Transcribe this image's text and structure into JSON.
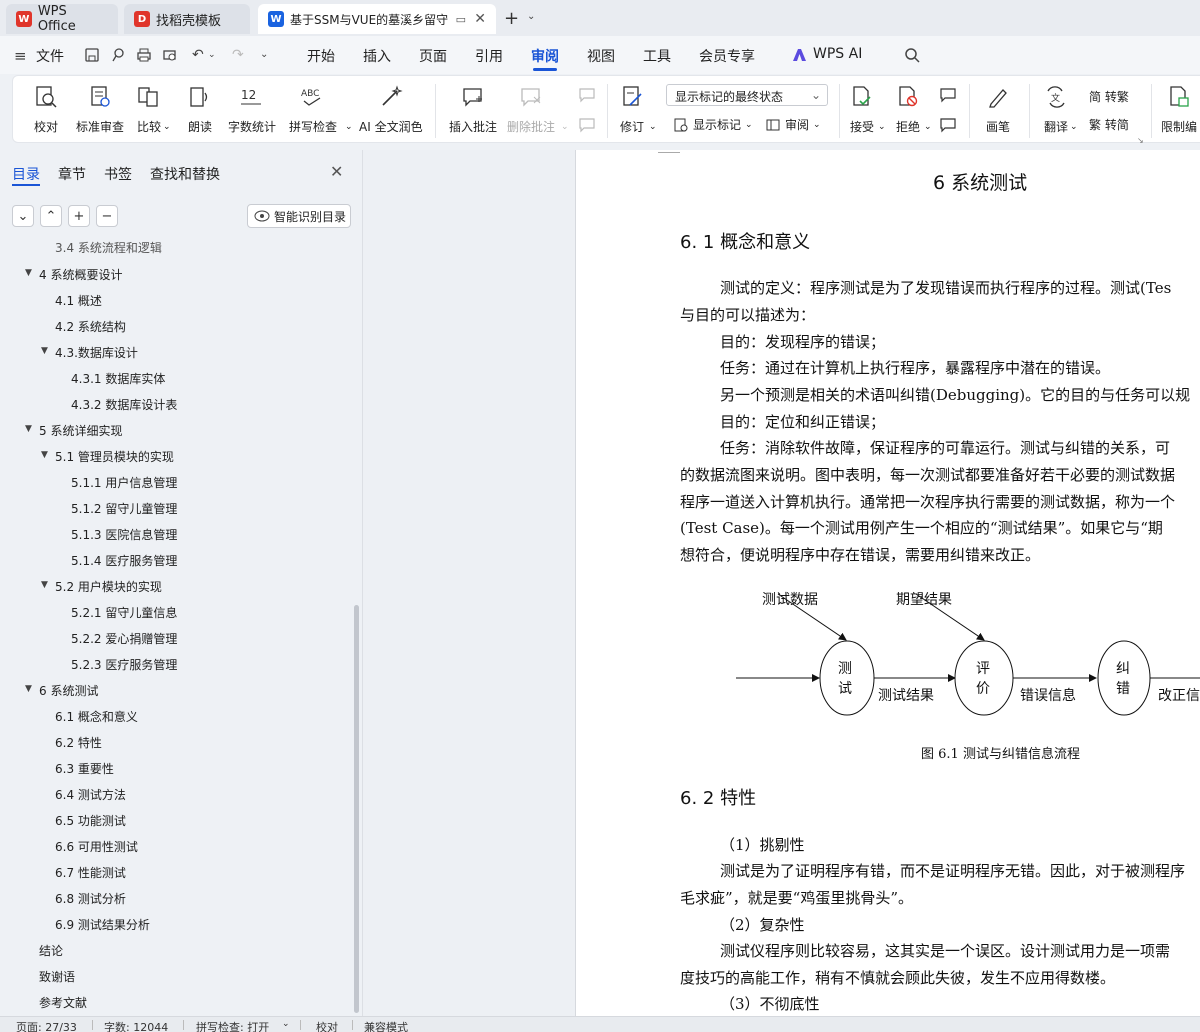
{
  "tabs": [
    {
      "label": "WPS Office",
      "icon": "wps-logo-icon"
    },
    {
      "label": "找稻壳模板",
      "icon": "docer-icon"
    },
    {
      "label": "基于SSM与VUE的墓溪乡留守",
      "icon": "writer-doc-icon"
    }
  ],
  "menu": {
    "file": "文件",
    "items": [
      "开始",
      "插入",
      "页面",
      "引用",
      "审阅",
      "视图",
      "工具",
      "会员专享"
    ],
    "active": "审阅",
    "wps_ai": "WPS AI"
  },
  "ribbon": {
    "proofread": "校对",
    "standard_review": "标准审查",
    "compare": "比较",
    "read_aloud": "朗读",
    "word_count": "字数统计",
    "spell_check": "拼写检查",
    "ai_polish": "AI 全文润色",
    "insert_comment": "插入批注",
    "delete_comment": "删除批注",
    "revise": "修订",
    "markup_view": "显示标记的最终状态",
    "show_markup": "显示标记",
    "review": "审阅",
    "accept": "接受",
    "reject": "拒绝",
    "pen": "画笔",
    "translate": "翻译",
    "to_traditional": "简 转繁",
    "to_simplified": "繁 转简",
    "restrict_edit": "限制编"
  },
  "nav_panel": {
    "tabs": [
      "目录",
      "章节",
      "书签",
      "查找和替换"
    ],
    "active_tab": "目录",
    "smart_toc": "智能识别目录",
    "toc": [
      {
        "label": "3.4 系统流程和逻辑",
        "level": 2,
        "arrow": false
      },
      {
        "label": "4 系统概要设计",
        "level": 1,
        "arrow": true
      },
      {
        "label": "4.1 概述",
        "level": 2,
        "arrow": false
      },
      {
        "label": "4.2 系统结构",
        "level": 2,
        "arrow": false
      },
      {
        "label": "4.3.数据库设计",
        "level": 2,
        "arrow": true
      },
      {
        "label": "4.3.1 数据库实体",
        "level": 3,
        "arrow": false
      },
      {
        "label": "4.3.2 数据库设计表",
        "level": 3,
        "arrow": false
      },
      {
        "label": "5 系统详细实现",
        "level": 1,
        "arrow": true
      },
      {
        "label": "5.1  管理员模块的实现",
        "level": 2,
        "arrow": true
      },
      {
        "label": "5.1.1  用户信息管理",
        "level": 3,
        "arrow": false
      },
      {
        "label": "5.1.2  留守儿童管理",
        "level": 3,
        "arrow": false
      },
      {
        "label": "5.1.3  医院信息管理",
        "level": 3,
        "arrow": false
      },
      {
        "label": "5.1.4  医疗服务管理",
        "level": 3,
        "arrow": false
      },
      {
        "label": "5.2  用户模块的实现",
        "level": 2,
        "arrow": true
      },
      {
        "label": "5.2.1  留守儿童信息",
        "level": 3,
        "arrow": false
      },
      {
        "label": "5.2.2  爱心捐赠管理",
        "level": 3,
        "arrow": false
      },
      {
        "label": "5.2.3  医疗服务管理",
        "level": 3,
        "arrow": false
      },
      {
        "label": "6 系统测试",
        "level": 1,
        "arrow": true
      },
      {
        "label": "6.1 概念和意义",
        "level": 2,
        "arrow": false
      },
      {
        "label": "6.2 特性",
        "level": 2,
        "arrow": false
      },
      {
        "label": "6.3 重要性",
        "level": 2,
        "arrow": false
      },
      {
        "label": "6.4 测试方法",
        "level": 2,
        "arrow": false
      },
      {
        "label": "6.5  功能测试",
        "level": 2,
        "arrow": false
      },
      {
        "label": "6.6 可用性测试",
        "level": 2,
        "arrow": false
      },
      {
        "label": "6.7 性能测试",
        "level": 2,
        "arrow": false
      },
      {
        "label": "6.8 测试分析",
        "level": 2,
        "arrow": false
      },
      {
        "label": "6.9 测试结果分析",
        "level": 2,
        "arrow": false
      },
      {
        "label": "结论",
        "level": 1,
        "arrow": false
      },
      {
        "label": "致谢语",
        "level": 1,
        "arrow": false
      },
      {
        "label": "参考文献",
        "level": 1,
        "arrow": false
      }
    ]
  },
  "document": {
    "chapter_title": "6 系统测试",
    "section1_title": "6. 1 概念和意义",
    "paragraphs": [
      "测试的定义：程序测试是为了发现错误而执行程序的过程。测试(Tes",
      "与目的可以描述为：",
      "目的：发现程序的错误；",
      "任务：通过在计算机上执行程序，暴露程序中潜在的错误。",
      "另一个预测是相关的术语叫纠错(Debugging)。它的目的与任务可以规",
      "目的：定位和纠正错误；",
      "任务：消除软件故障，保证程序的可靠运行。测试与纠错的关系，可",
      "的数据流图来说明。图中表明，每一次测试都要准备好若干必要的测试数据",
      "程序一道送入计算机执行。通常把一次程序执行需要的测试数据，称为一个",
      "(Test Case)。每一个测试用例产生一个相应的“测试结果”。如果它与“期",
      "想符合，便说明程序中存在错误，需要用纠错来改正。"
    ],
    "diagram": {
      "input_label": "测试数据",
      "expected_label": "期望结果",
      "node1": "测\n试",
      "node2": "评\n价",
      "node3": "纠\n错",
      "edge1": "测试结果",
      "edge2": "错误信息",
      "edge3": "改正信"
    },
    "figure_caption": "图 6.1 测试与纠错信息流程",
    "section2_title": "6. 2 特性",
    "paragraphs2": [
      "（1）挑剔性",
      "测试是为了证明程序有错，而不是证明程序无错。因此，对于被测程序",
      "毛求疵”，就是要“鸡蛋里挑骨头”。",
      "（2）复杂性",
      "测试仪程序则比较容易，这其实是一个误区。设计测试用力是一项需",
      "度技巧的高能工作，稍有不慎就会顾此失彼，发生不应用得数楼。",
      "（3）不彻底性"
    ]
  },
  "status": {
    "page": "页面: 27/33",
    "words": "字数: 12044",
    "spell": "拼写检查: 打开",
    "proof": "校对",
    "compat": "兼容模式"
  },
  "colors": {
    "accent": "#1a55d6",
    "wps_red": "#e0352b"
  }
}
